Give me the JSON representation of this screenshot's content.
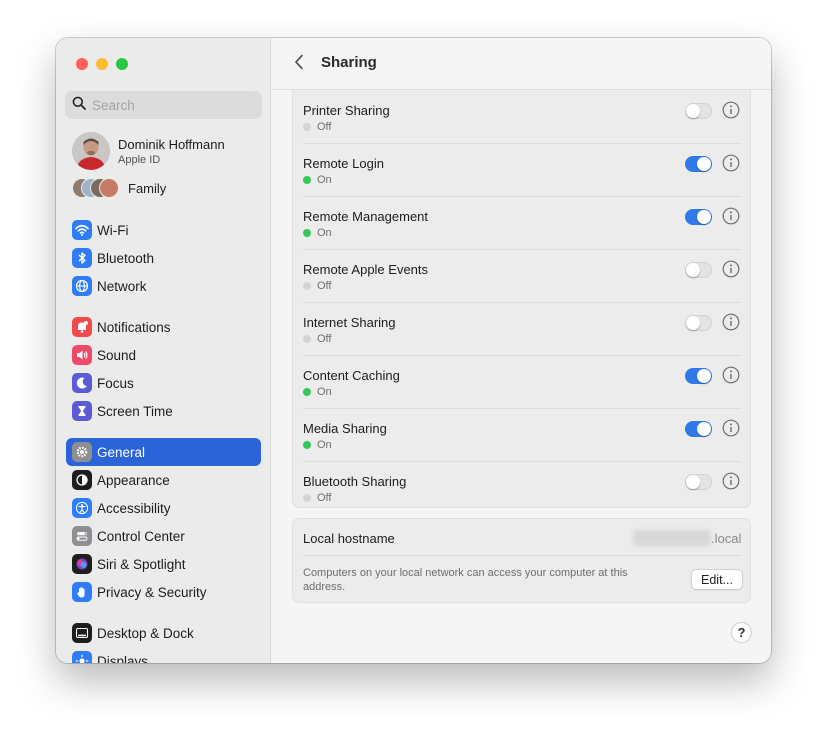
{
  "sidebar": {
    "search_placeholder": "Search",
    "profile": {
      "name": "Dominik Hoffmann",
      "subtitle": "Apple ID"
    },
    "family_label": "Family",
    "items": [
      {
        "label": "Wi-Fi",
        "icon": "wifi-icon",
        "color": "#2f7cf6"
      },
      {
        "label": "Bluetooth",
        "icon": "bluetooth-icon",
        "color": "#2f7cf6"
      },
      {
        "label": "Network",
        "icon": "globe-icon",
        "color": "#2f7cf6"
      },
      {
        "label": "Notifications",
        "icon": "bell-icon",
        "color": "#f04a4a"
      },
      {
        "label": "Sound",
        "icon": "speaker-icon",
        "color": "#f04a6a"
      },
      {
        "label": "Focus",
        "icon": "moon-icon",
        "color": "#5b5bd6"
      },
      {
        "label": "Screen Time",
        "icon": "hourglass-icon",
        "color": "#5b5bd6"
      },
      {
        "label": "General",
        "icon": "gear-icon",
        "color": "#8e8e93"
      },
      {
        "label": "Appearance",
        "icon": "appearance-icon",
        "color": "#1d1d1f"
      },
      {
        "label": "Accessibility",
        "icon": "accessibility-icon",
        "color": "#2f7cf6"
      },
      {
        "label": "Control Center",
        "icon": "control-center-icon",
        "color": "#8e8e93"
      },
      {
        "label": "Siri & Spotlight",
        "icon": "siri-icon",
        "color": "#7a3fd1"
      },
      {
        "label": "Privacy & Security",
        "icon": "hand-icon",
        "color": "#2f7cf6"
      },
      {
        "label": "Desktop & Dock",
        "icon": "dock-icon",
        "color": "#1d1d1f"
      },
      {
        "label": "Displays",
        "icon": "displays-icon",
        "color": "#2f7cf6"
      }
    ],
    "selected": "General",
    "selected_color": "#2b63d9"
  },
  "header": {
    "title": "Sharing"
  },
  "services": [
    {
      "name": "Printer Sharing",
      "status": "Off",
      "on": false
    },
    {
      "name": "Remote Login",
      "status": "On",
      "on": true
    },
    {
      "name": "Remote Management",
      "status": "On",
      "on": true
    },
    {
      "name": "Remote Apple Events",
      "status": "Off",
      "on": false
    },
    {
      "name": "Internet Sharing",
      "status": "Off",
      "on": false
    },
    {
      "name": "Content Caching",
      "status": "On",
      "on": true
    },
    {
      "name": "Media Sharing",
      "status": "On",
      "on": true
    },
    {
      "name": "Bluetooth Sharing",
      "status": "Off",
      "on": false
    }
  ],
  "hostname": {
    "label": "Local hostname",
    "suffix": ".local",
    "description": "Computers on your local network can access your computer at this address.",
    "edit_label": "Edit..."
  },
  "help_label": "?",
  "colors": {
    "toggle_on": "#2f79e9",
    "status_on": "#34c759",
    "status_off": "#d4d4d4"
  }
}
